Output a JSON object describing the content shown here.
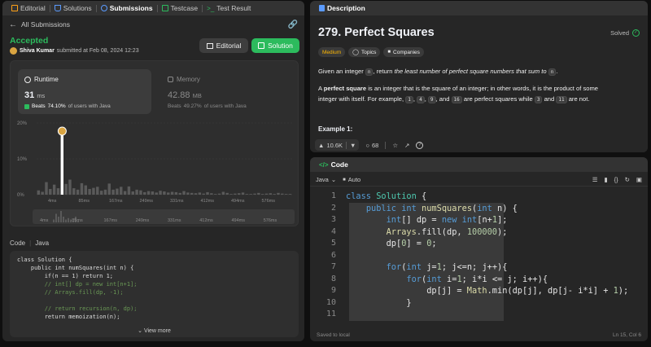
{
  "left_tabs": [
    {
      "label": "Editorial",
      "icon": "book-icon",
      "color": "#ffa116",
      "active": false
    },
    {
      "label": "Solutions",
      "icon": "flask-icon",
      "color": "#5b9bff",
      "active": false
    },
    {
      "label": "Submissions",
      "icon": "history-icon",
      "color": "#5b9bff",
      "active": true
    },
    {
      "label": "Testcase",
      "icon": "checkbox-icon",
      "color": "#2cbb5d",
      "active": false
    },
    {
      "label": "Test Result",
      "icon": "terminal-icon",
      "color": "#2cbb5d",
      "active": false
    }
  ],
  "submission": {
    "back_label": "All Submissions",
    "status": "Accepted",
    "user": "Shiva Kumar",
    "submitted_text": "submitted at Feb 08, 2024 12:23",
    "editorial_btn": "Editorial",
    "solution_btn": "Solution"
  },
  "runtime": {
    "label": "Runtime",
    "value": "31",
    "unit": "ms",
    "beats_prefix": "Beats",
    "beats_pct": "74.10%",
    "beats_suffix": "of users with Java"
  },
  "memory": {
    "label": "Memory",
    "value": "42.88",
    "unit": "MB",
    "beats_prefix": "Beats",
    "beats_pct": "49.27%",
    "beats_suffix": "of users with Java"
  },
  "chart_data": {
    "type": "bar",
    "yticks": [
      "20%",
      "10%",
      "0%"
    ],
    "ylim": [
      0,
      20
    ],
    "xticks": [
      "4ms",
      "85ms",
      "167ms",
      "249ms",
      "331ms",
      "412ms",
      "494ms",
      "576ms"
    ],
    "values": [
      1.2,
      0.8,
      3.5,
      1.6,
      2.8,
      1.8,
      17.5,
      3.0,
      4.2,
      1.8,
      1.4,
      3.2,
      2.6,
      1.6,
      1.9,
      2.2,
      1.1,
      1.4,
      3.1,
      1.4,
      1.7,
      2.2,
      1.0,
      2.3,
      0.9,
      1.4,
      1.2,
      0.7,
      1.0,
      0.9,
      0.6,
      1.1,
      0.9,
      0.6,
      0.8,
      0.7,
      0.5,
      1.0,
      0.6,
      0.5,
      0.4,
      0.6,
      0.3,
      0.7,
      0.4,
      0.2,
      0.3,
      0.8,
      0.5,
      0.2,
      0.3,
      0.4,
      0.6,
      0.2,
      0.2,
      0.3,
      0.5,
      0.2,
      0.3,
      0.4,
      0.2,
      0.5,
      0.3,
      0.2,
      0.2
    ],
    "highlight_index": 6,
    "mini_values": [
      1,
      3,
      2,
      4,
      2,
      1,
      1.5,
      1,
      0.5,
      2,
      0.5
    ]
  },
  "code_header": {
    "label": "Code",
    "lang": "Java"
  },
  "code_snippet": [
    "class Solution {",
    "    public int numSquares(int n) {",
    "        if(n == 1) return 1;",
    "        // int[] dp = new int[n+1];",
    "        // Arrays.fill(dp, -1);",
    "",
    "        // return recursion(n, dp);",
    "        return memoization(n);"
  ],
  "view_more": "View more",
  "description": {
    "tab_label": "Description",
    "title": "279. Perfect Squares",
    "solved": "Solved",
    "difficulty": "Medium",
    "topics": "Topics",
    "companies": "Companies",
    "p1_a": "Given an integer ",
    "p1_code": "n",
    "p1_b": ", return ",
    "p1_em": "the least number of perfect square numbers that sum to",
    "p1_code2": "n",
    "p1_c": ".",
    "p2_a": "A ",
    "p2_strong": "perfect square",
    "p2_b": " is an integer that is the square of an integer; in other words, it is the product of some",
    "p3_a": "integer with itself. For example, ",
    "ex": [
      "1",
      "4",
      "9",
      "16"
    ],
    "p3_b": " are perfect squares while ",
    "ex2": [
      "3",
      "11"
    ],
    "p3_c": " are not.",
    "example_label": "Example 1:",
    "likes": "10.6K",
    "comments": "68"
  },
  "editor": {
    "tab_label": "Code",
    "lang": "Java",
    "auto": "Auto",
    "saved": "Saved to local",
    "cursor": "Ln 15, Col 6",
    "line_numbers": [
      "1",
      "2",
      "3",
      "4",
      "5",
      "6",
      "7",
      "8",
      "9",
      "10",
      "11"
    ]
  }
}
